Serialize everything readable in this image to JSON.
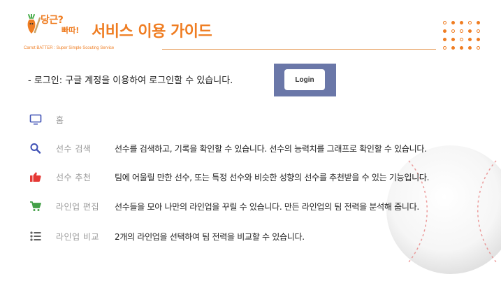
{
  "header": {
    "logo": {
      "main": "당근?",
      "sub": "빠따!",
      "tagline": "Carrot BATTER : Super Simple Scouting Service"
    },
    "title": "서비스 이용 가이드"
  },
  "login": {
    "description": "- 로그인: 구글 계정을 이용하여 로그인할 수 있습니다.",
    "button_label": "Login"
  },
  "features": [
    {
      "icon": "monitor-icon",
      "label": "홈",
      "description": ""
    },
    {
      "icon": "search-icon",
      "label": "선수 검색",
      "description": "선수를 검색하고, 기록을 확인할 수 있습니다. 선수의 능력치를 그래프로 확인할 수 있습니다."
    },
    {
      "icon": "thumbs-up-icon",
      "label": "선수 추천",
      "description": "팀에 어울릴 만한 선수, 또는 특정 선수와 비슷한 성향의 선수를 추천받을 수 있는 기능입니다."
    },
    {
      "icon": "cart-icon",
      "label": "라인업 편집",
      "description": "선수들을 모아 나만의 라인업을 꾸릴 수 있습니다. 만든 라인업의 팀 전력을 분석해 줍니다."
    },
    {
      "icon": "list-icon",
      "label": "라인업 비교",
      "description": "2개의 라인업을 선택하여 팀 전력을 비교할 수 있습니다."
    }
  ],
  "colors": {
    "accent": "#ef7d22",
    "icon_blue": "#3f51b5",
    "icon_red": "#e53935",
    "icon_green": "#43a047",
    "icon_gray": "#616161",
    "login_panel": "#6a77a8"
  }
}
